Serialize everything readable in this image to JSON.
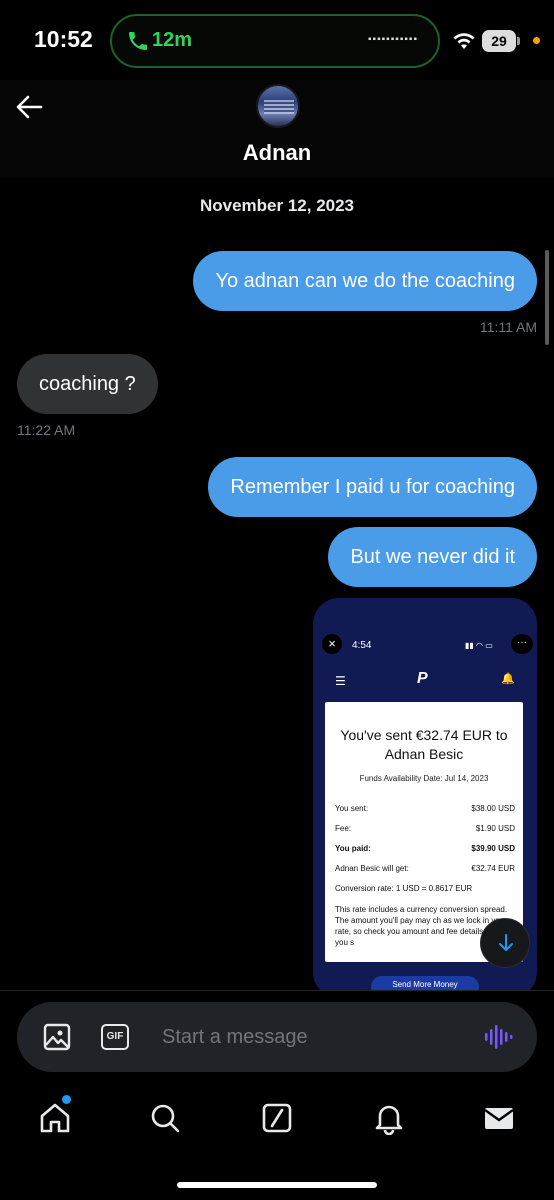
{
  "status_bar": {
    "time": "10:52",
    "call_duration": "12m",
    "battery": "29",
    "icons": [
      "phone-icon",
      "wifi-icon",
      "battery-icon"
    ]
  },
  "header": {
    "contact_name": "Adnan",
    "back_icon": "back-arrow-icon"
  },
  "conversation": {
    "date": "November 12, 2023",
    "messages": [
      {
        "direction": "out",
        "text": "Yo adnan can we do the coaching",
        "time": "11:11 AM"
      },
      {
        "direction": "in",
        "text": "coaching ?",
        "time": "11:22 AM"
      },
      {
        "direction": "out",
        "text": "Remember I paid u for coaching",
        "time": ""
      },
      {
        "direction": "out",
        "text": "But we never did it",
        "time": ""
      }
    ]
  },
  "attachment": {
    "time": "4:54",
    "close": "×",
    "more": "···",
    "title": "You've sent €32.74 EUR to Adnan Besic",
    "funds_date": "Funds Availability Date: Jul 14, 2023",
    "rows": [
      {
        "label": "You sent:",
        "value": "$38.00 USD"
      },
      {
        "label": "Fee:",
        "value": "$1.90 USD"
      },
      {
        "label": "You paid:",
        "value": "$39.90 USD"
      },
      {
        "label": "Adnan Besic will get:",
        "value": "€32.74 EUR"
      }
    ],
    "conversion": "Conversion rate: 1 USD = 0.8617 EUR",
    "note": "This rate includes a currency conversion spread. The amount you'll pay may ch as we lock in your rate, so check you amount and fee details before you s",
    "button": "Send More Money"
  },
  "composer": {
    "placeholder": "Start a message",
    "gif_label": "GIF"
  },
  "bottom_nav": [
    "home-icon",
    "search-icon",
    "grok-icon",
    "notifications-icon",
    "messages-icon"
  ],
  "colors": {
    "outgoing_bubble": "#4a9be8",
    "incoming_bubble": "#2f3336",
    "accent": "#1d9bf0",
    "voice": "#7856ff"
  }
}
